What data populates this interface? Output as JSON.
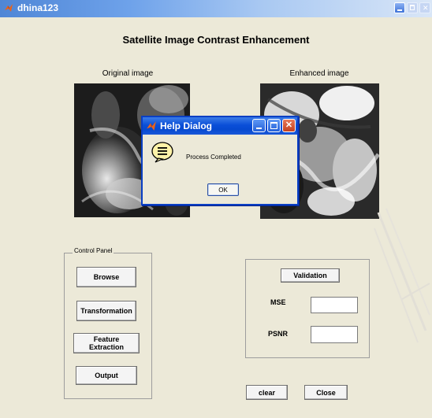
{
  "window": {
    "title": "dhina123",
    "controls": [
      "minimize-icon",
      "maximize-icon",
      "close-icon"
    ]
  },
  "app": {
    "heading": "Satellite Image Contrast Enhancement",
    "original_label": "Original image",
    "enhanced_label": "Enhanced image"
  },
  "control_panel": {
    "title": "Control Panel",
    "browse": "Browse",
    "transformation": "Transformation",
    "feature_extraction": "Feature Extraction",
    "output": "Output"
  },
  "validation_panel": {
    "validation": "Validation",
    "mse_label": "MSE",
    "mse_value": "",
    "psnr_label": "PSNR",
    "psnr_value": ""
  },
  "footer": {
    "clear": "clear",
    "close": "Close"
  },
  "dialog": {
    "title": "Help Dialog",
    "message": "Process Completed",
    "ok": "OK",
    "icon": "help-speech-bubble-icon"
  },
  "colors": {
    "window_bg": "#ece9d8",
    "titlebar_start": "#4f86d6",
    "dialog_titlebar": "#0a4fd8",
    "dialog_close": "#c4401f"
  }
}
